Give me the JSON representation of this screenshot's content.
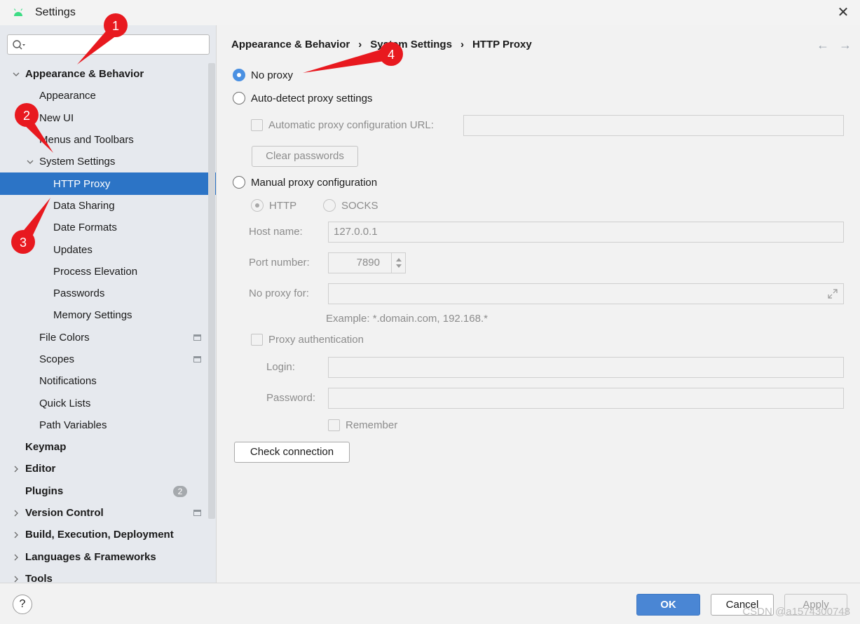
{
  "window": {
    "title": "Settings",
    "close_glyph": "✕"
  },
  "search": {
    "placeholder": ""
  },
  "sidebar": {
    "items": [
      {
        "label": "Appearance & Behavior",
        "level": 0,
        "expanded": true,
        "bold": true
      },
      {
        "label": "Appearance",
        "level": 1
      },
      {
        "label": "New UI",
        "level": 1
      },
      {
        "label": "Menus and Toolbars",
        "level": 1
      },
      {
        "label": "System Settings",
        "level": 1,
        "expanded": true
      },
      {
        "label": "HTTP Proxy",
        "level": 2,
        "selected": true
      },
      {
        "label": "Data Sharing",
        "level": 2
      },
      {
        "label": "Date Formats",
        "level": 2
      },
      {
        "label": "Updates",
        "level": 2
      },
      {
        "label": "Process Elevation",
        "level": 2
      },
      {
        "label": "Passwords",
        "level": 2
      },
      {
        "label": "Memory Settings",
        "level": 2
      },
      {
        "label": "File Colors",
        "level": 1,
        "project_icon": true
      },
      {
        "label": "Scopes",
        "level": 1,
        "project_icon": true
      },
      {
        "label": "Notifications",
        "level": 1
      },
      {
        "label": "Quick Lists",
        "level": 1
      },
      {
        "label": "Path Variables",
        "level": 1
      },
      {
        "label": "Keymap",
        "level": 0,
        "bold": true
      },
      {
        "label": "Editor",
        "level": 0,
        "bold": true,
        "collapsed": true
      },
      {
        "label": "Plugins",
        "level": 0,
        "bold": true,
        "badge": "2"
      },
      {
        "label": "Version Control",
        "level": 0,
        "bold": true,
        "collapsed": true,
        "project_icon": true
      },
      {
        "label": "Build, Execution, Deployment",
        "level": 0,
        "bold": true,
        "collapsed": true
      },
      {
        "label": "Languages & Frameworks",
        "level": 0,
        "bold": true,
        "collapsed": true
      },
      {
        "label": "Tools",
        "level": 0,
        "bold": true,
        "collapsed": true
      }
    ]
  },
  "breadcrumb": [
    "Appearance & Behavior",
    "System Settings",
    "HTTP Proxy"
  ],
  "breadcrumb_sep": "›",
  "nav": {
    "back": "←",
    "forward": "→"
  },
  "proxy": {
    "no_proxy": "No proxy",
    "auto_detect": "Auto-detect proxy settings",
    "auto_url_label": "Automatic proxy configuration URL:",
    "auto_url_value": "",
    "clear_passwords": "Clear passwords",
    "manual": "Manual proxy configuration",
    "http": "HTTP",
    "socks": "SOCKS",
    "host_label": "Host name:",
    "host_value": "127.0.0.1",
    "port_label": "Port number:",
    "port_value": "7890",
    "no_proxy_for_label": "No proxy for:",
    "no_proxy_for_value": "",
    "example": "Example: *.domain.com, 192.168.*",
    "proxy_auth": "Proxy authentication",
    "login_label": "Login:",
    "login_value": "",
    "password_label": "Password:",
    "password_value": "",
    "remember": "Remember",
    "check_connection": "Check connection"
  },
  "footer": {
    "help": "?",
    "ok": "OK",
    "cancel": "Cancel",
    "apply": "Apply",
    "watermark": "CSDN @a1574300748"
  },
  "annotations": [
    "1",
    "2",
    "3",
    "4"
  ],
  "colors": {
    "selection": "#2c74c6",
    "annotation": "#e8191f",
    "ok_button": "#4a86d4",
    "radio_checked": "#4a90e2"
  },
  "icons": {
    "app": "android-icon",
    "search": "search-icon",
    "close": "close-icon"
  }
}
